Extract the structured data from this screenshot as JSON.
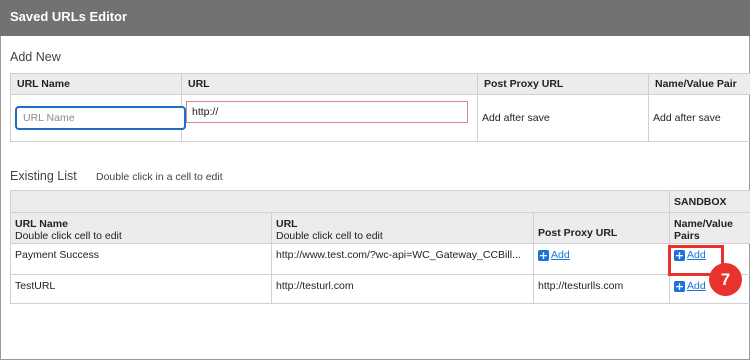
{
  "window": {
    "title": "Saved URLs Editor"
  },
  "add_new": {
    "heading": "Add New",
    "columns": [
      "URL Name",
      "URL",
      "Post Proxy URL",
      "Name/Value Pair"
    ],
    "name_placeholder": "URL Name",
    "url_value": "http://",
    "post_proxy_text": "Add after save",
    "name_value_text": "Add after save"
  },
  "existing": {
    "heading": "Existing List",
    "hint": "Double click in a cell to edit",
    "group_header": "SANDBOX",
    "columns": [
      {
        "title": "URL Name",
        "sub": "Double click cell to edit"
      },
      {
        "title": "URL",
        "sub": "Double click cell to edit"
      },
      {
        "title": "Post Proxy URL",
        "sub": ""
      },
      {
        "title": "Name/Value",
        "sub": "Pairs"
      }
    ],
    "rows": [
      {
        "name": "Payment Success",
        "url": "http://www.test.com/?wc-api=WC_Gateway_CCBill...",
        "post_proxy": "",
        "post_proxy_link": "Add",
        "pairs_link": "Add"
      },
      {
        "name": "TestURL",
        "url": "http://testurl.com",
        "post_proxy": "http://testurlls.com",
        "post_proxy_link": "",
        "pairs_link": "Add"
      }
    ]
  },
  "annotation": {
    "step_number": "7",
    "color": "#e8322e"
  },
  "colors": {
    "titlebar": "#727272",
    "link": "#1a73d9",
    "header_bg": "#ececec"
  }
}
